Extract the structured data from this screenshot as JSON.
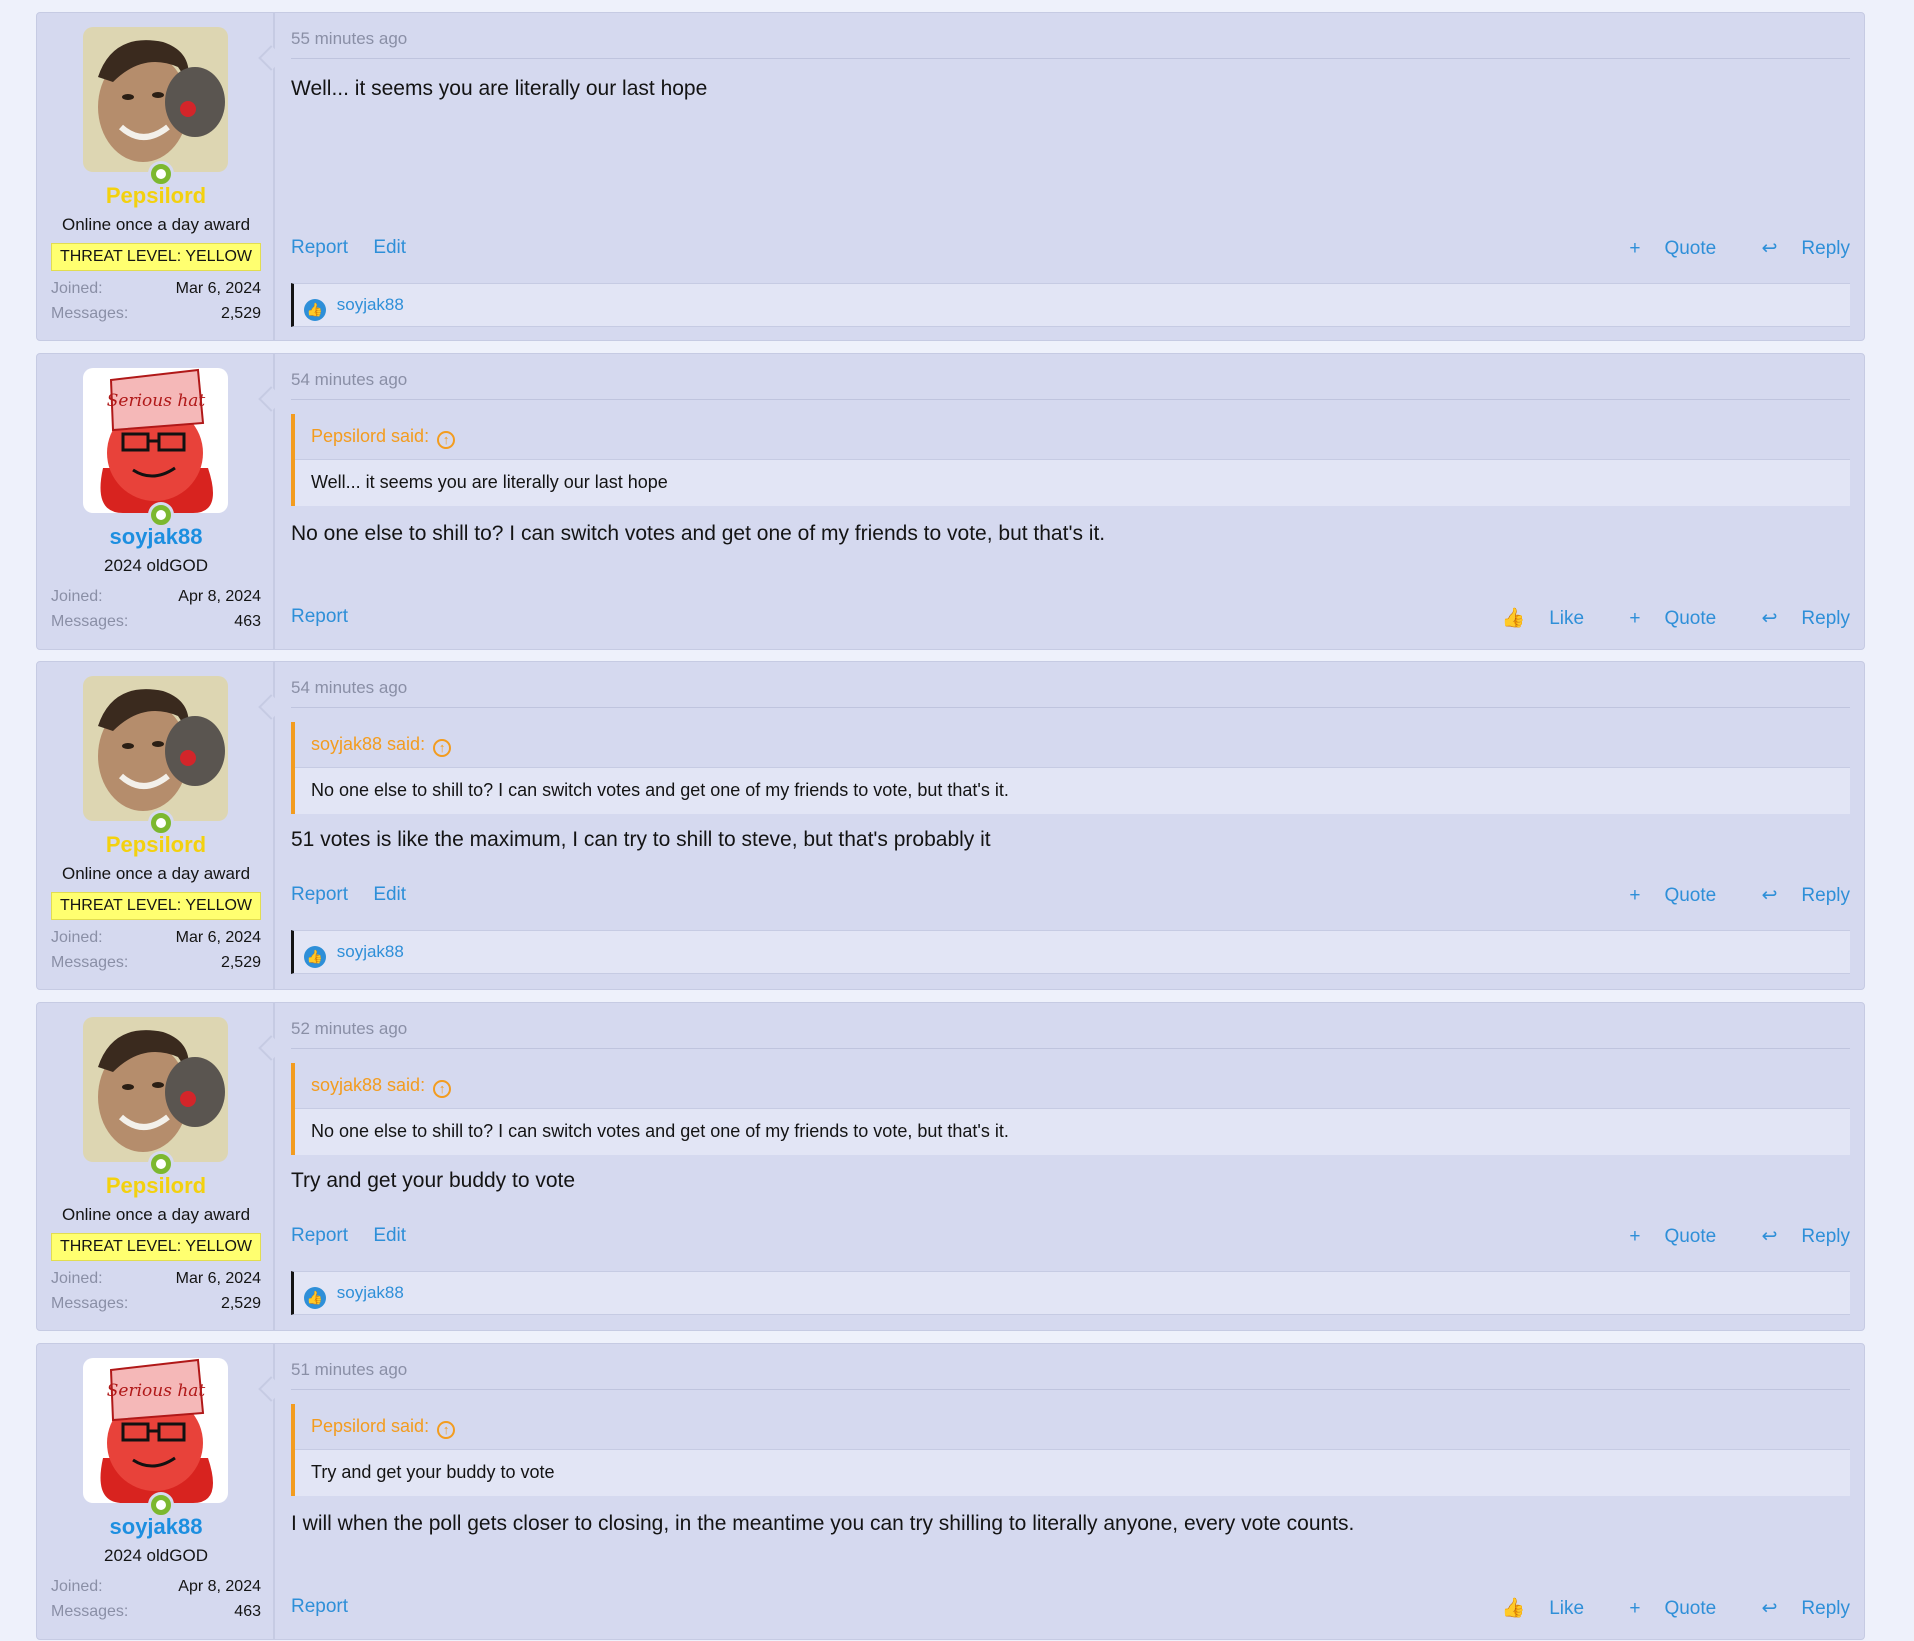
{
  "colors": {
    "pepsilord_name": "#f3d10f",
    "soyjak_name": "#1d8fe0",
    "link": "#2e8fd8",
    "quote_accent": "#f39c1f",
    "banner_bg": "#ffff70",
    "online": "#7cb82f"
  },
  "users": {
    "pepsilord": {
      "name": "Pepsilord",
      "title": "Online once a day award",
      "banner": "THREAT LEVEL: YELLOW",
      "joined_label": "Joined:",
      "joined": "Mar 6, 2024",
      "messages_label": "Messages:",
      "messages": "2,529"
    },
    "soyjak88": {
      "name": "soyjak88",
      "title": "2024 oldGOD",
      "joined_label": "Joined:",
      "joined": "Apr 8, 2024",
      "messages_label": "Messages:",
      "messages": "463"
    }
  },
  "avatars": {
    "soyjak_hat_text": "Serious hat"
  },
  "posts": [
    {
      "time": "55 minutes ago",
      "message": "Well... it seems you are literally our last hope",
      "actions_left": [
        "Report",
        "Edit"
      ],
      "quote_label": "Quote",
      "reply_label": "Reply",
      "likes": "soyjak88"
    },
    {
      "time": "54 minutes ago",
      "quote_author": "Pepsilord said:",
      "quote_text": "Well... it seems you are literally our last hope",
      "message": "No one else to shill to? I can switch votes and get one of my friends to vote, but that's it.",
      "actions_left": [
        "Report"
      ],
      "like_label": "Like",
      "quote_label": "Quote",
      "reply_label": "Reply"
    },
    {
      "time": "54 minutes ago",
      "quote_author": "soyjak88 said:",
      "quote_text": "No one else to shill to? I can switch votes and get one of my friends to vote, but that's it.",
      "message": "51 votes is like the maximum, I can try to shill to steve, but that's probably it",
      "actions_left": [
        "Report",
        "Edit"
      ],
      "quote_label": "Quote",
      "reply_label": "Reply",
      "likes": "soyjak88"
    },
    {
      "time": "52 minutes ago",
      "quote_author": "soyjak88 said:",
      "quote_text": "No one else to shill to? I can switch votes and get one of my friends to vote, but that's it.",
      "message": "Try and get your buddy to vote",
      "actions_left": [
        "Report",
        "Edit"
      ],
      "quote_label": "Quote",
      "reply_label": "Reply",
      "likes": "soyjak88"
    },
    {
      "time": "51 minutes ago",
      "quote_author": "Pepsilord said:",
      "quote_text": "Try and get your buddy to vote",
      "message": "I will when the poll gets closer to closing, in the meantime you can try shilling to literally anyone, every vote counts.",
      "actions_left": [
        "Report"
      ],
      "like_label": "Like",
      "quote_label": "Quote",
      "reply_label": "Reply"
    }
  ]
}
